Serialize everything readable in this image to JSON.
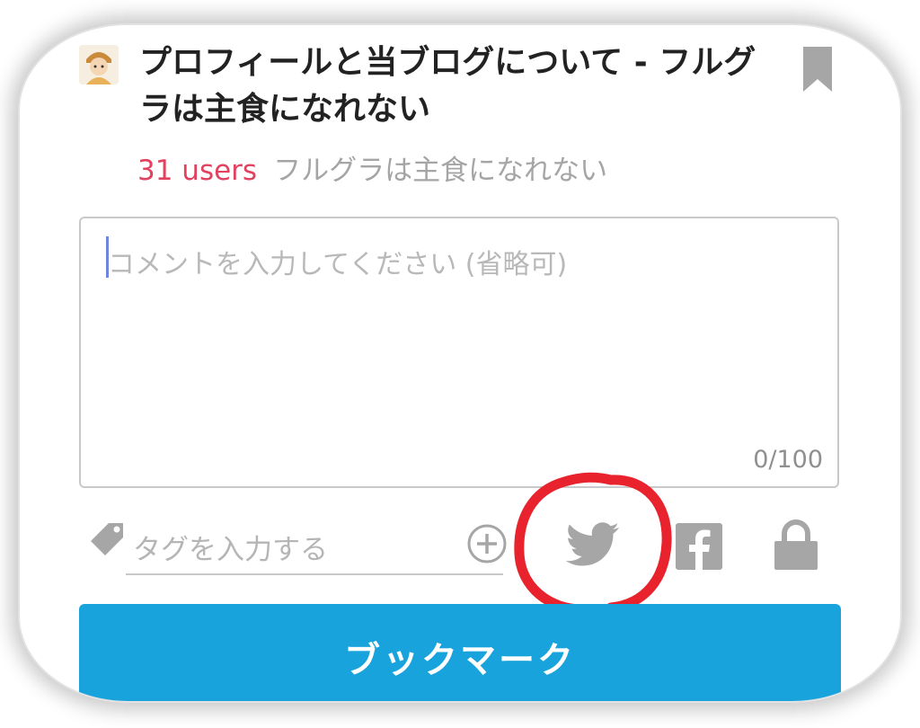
{
  "entry": {
    "title": "プロフィールと当ブログについて - フルグラは主食になれない",
    "users": "31 users",
    "site_name": "フルグラは主食になれない"
  },
  "comment": {
    "value": "",
    "placeholder": "コメントを入力してください (省略可)",
    "counter": "0/100"
  },
  "tags": {
    "placeholder": "タグを入力する"
  },
  "share": {
    "icons": [
      "tag-icon",
      "add-tag-icon",
      "twitter-icon",
      "facebook-icon",
      "lock-icon",
      "bookmark-flag-icon"
    ],
    "highlight": "twitter"
  },
  "actions": {
    "bookmark_label": "ブックマーク"
  },
  "colors": {
    "users": "#e0425f",
    "button": "#19a3dd",
    "annotation": "#e8232d",
    "icon_grey": "#a6a6a6"
  }
}
